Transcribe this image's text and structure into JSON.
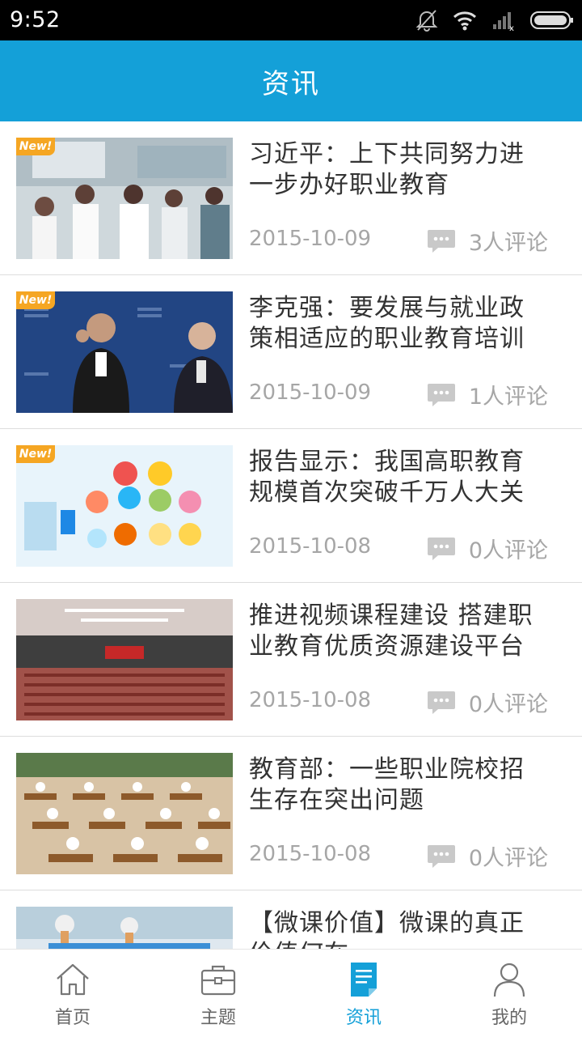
{
  "status_bar": {
    "time": "9:52"
  },
  "header": {
    "title": "资讯"
  },
  "badge_label": "New!",
  "news": [
    {
      "title": "习近平：上下共同努力进一步办好职业教育",
      "date": "2015-10-09",
      "comments": "3人评论",
      "is_new": true
    },
    {
      "title": "李克强：要发展与就业政策相适应的职业教育培训",
      "date": "2015-10-09",
      "comments": "1人评论",
      "is_new": true
    },
    {
      "title": "报告显示：我国高职教育规模首次突破千万人大关",
      "date": "2015-10-08",
      "comments": "0人评论",
      "is_new": true
    },
    {
      "title": "推进视频课程建设 搭建职业教育优质资源建设平台",
      "date": "2015-10-08",
      "comments": "0人评论",
      "is_new": false
    },
    {
      "title": "教育部：一些职业院校招生存在突出问题",
      "date": "2015-10-08",
      "comments": "0人评论",
      "is_new": false
    },
    {
      "title": "【微课价值】微课的真正价值何在",
      "date": "",
      "comments": "",
      "is_new": false
    }
  ],
  "tabs": [
    {
      "label": "首页",
      "icon": "home-icon"
    },
    {
      "label": "主题",
      "icon": "briefcase-icon"
    },
    {
      "label": "资讯",
      "icon": "document-icon",
      "active": true
    },
    {
      "label": "我的",
      "icon": "person-icon"
    }
  ],
  "colors": {
    "primary": "#14a0d8",
    "badge": "#f5a623",
    "muted": "#a6a6a6",
    "title_text": "#333333"
  }
}
